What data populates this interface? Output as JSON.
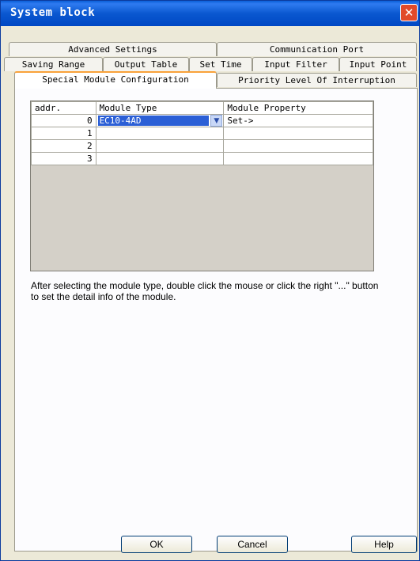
{
  "window": {
    "title": "System block",
    "close_symbol": "✕"
  },
  "tabs": [
    {
      "label": "Advanced Settings"
    },
    {
      "label": "Communication Port"
    },
    {
      "label": "Saving Range"
    },
    {
      "label": "Output Table"
    },
    {
      "label": "Set Time"
    },
    {
      "label": "Input Filter"
    },
    {
      "label": "Input Point"
    },
    {
      "label": "Special Module Configuration",
      "active": true
    },
    {
      "label": "Priority Level Of Interruption"
    }
  ],
  "table": {
    "headers": [
      "addr.",
      "Module Type",
      "Module Property"
    ],
    "rows": [
      {
        "addr": "0",
        "module_type": "EC10-4AD",
        "module_property": "Set->"
      },
      {
        "addr": "1",
        "module_type": "",
        "module_property": ""
      },
      {
        "addr": "2",
        "module_type": "",
        "module_property": ""
      },
      {
        "addr": "3",
        "module_type": "",
        "module_property": ""
      }
    ]
  },
  "help_text": "After selecting the module type, double click the mouse or click the right \"...\" button to set the detail info of the module.",
  "buttons": {
    "ok": "OK",
    "cancel": "Cancel",
    "help": "Help"
  },
  "colors": {
    "title_bar": "#0a58d0",
    "selection": "#2b5fd6",
    "active_tab_accent": "#f9a23a",
    "close_button": "#e14a2a"
  }
}
